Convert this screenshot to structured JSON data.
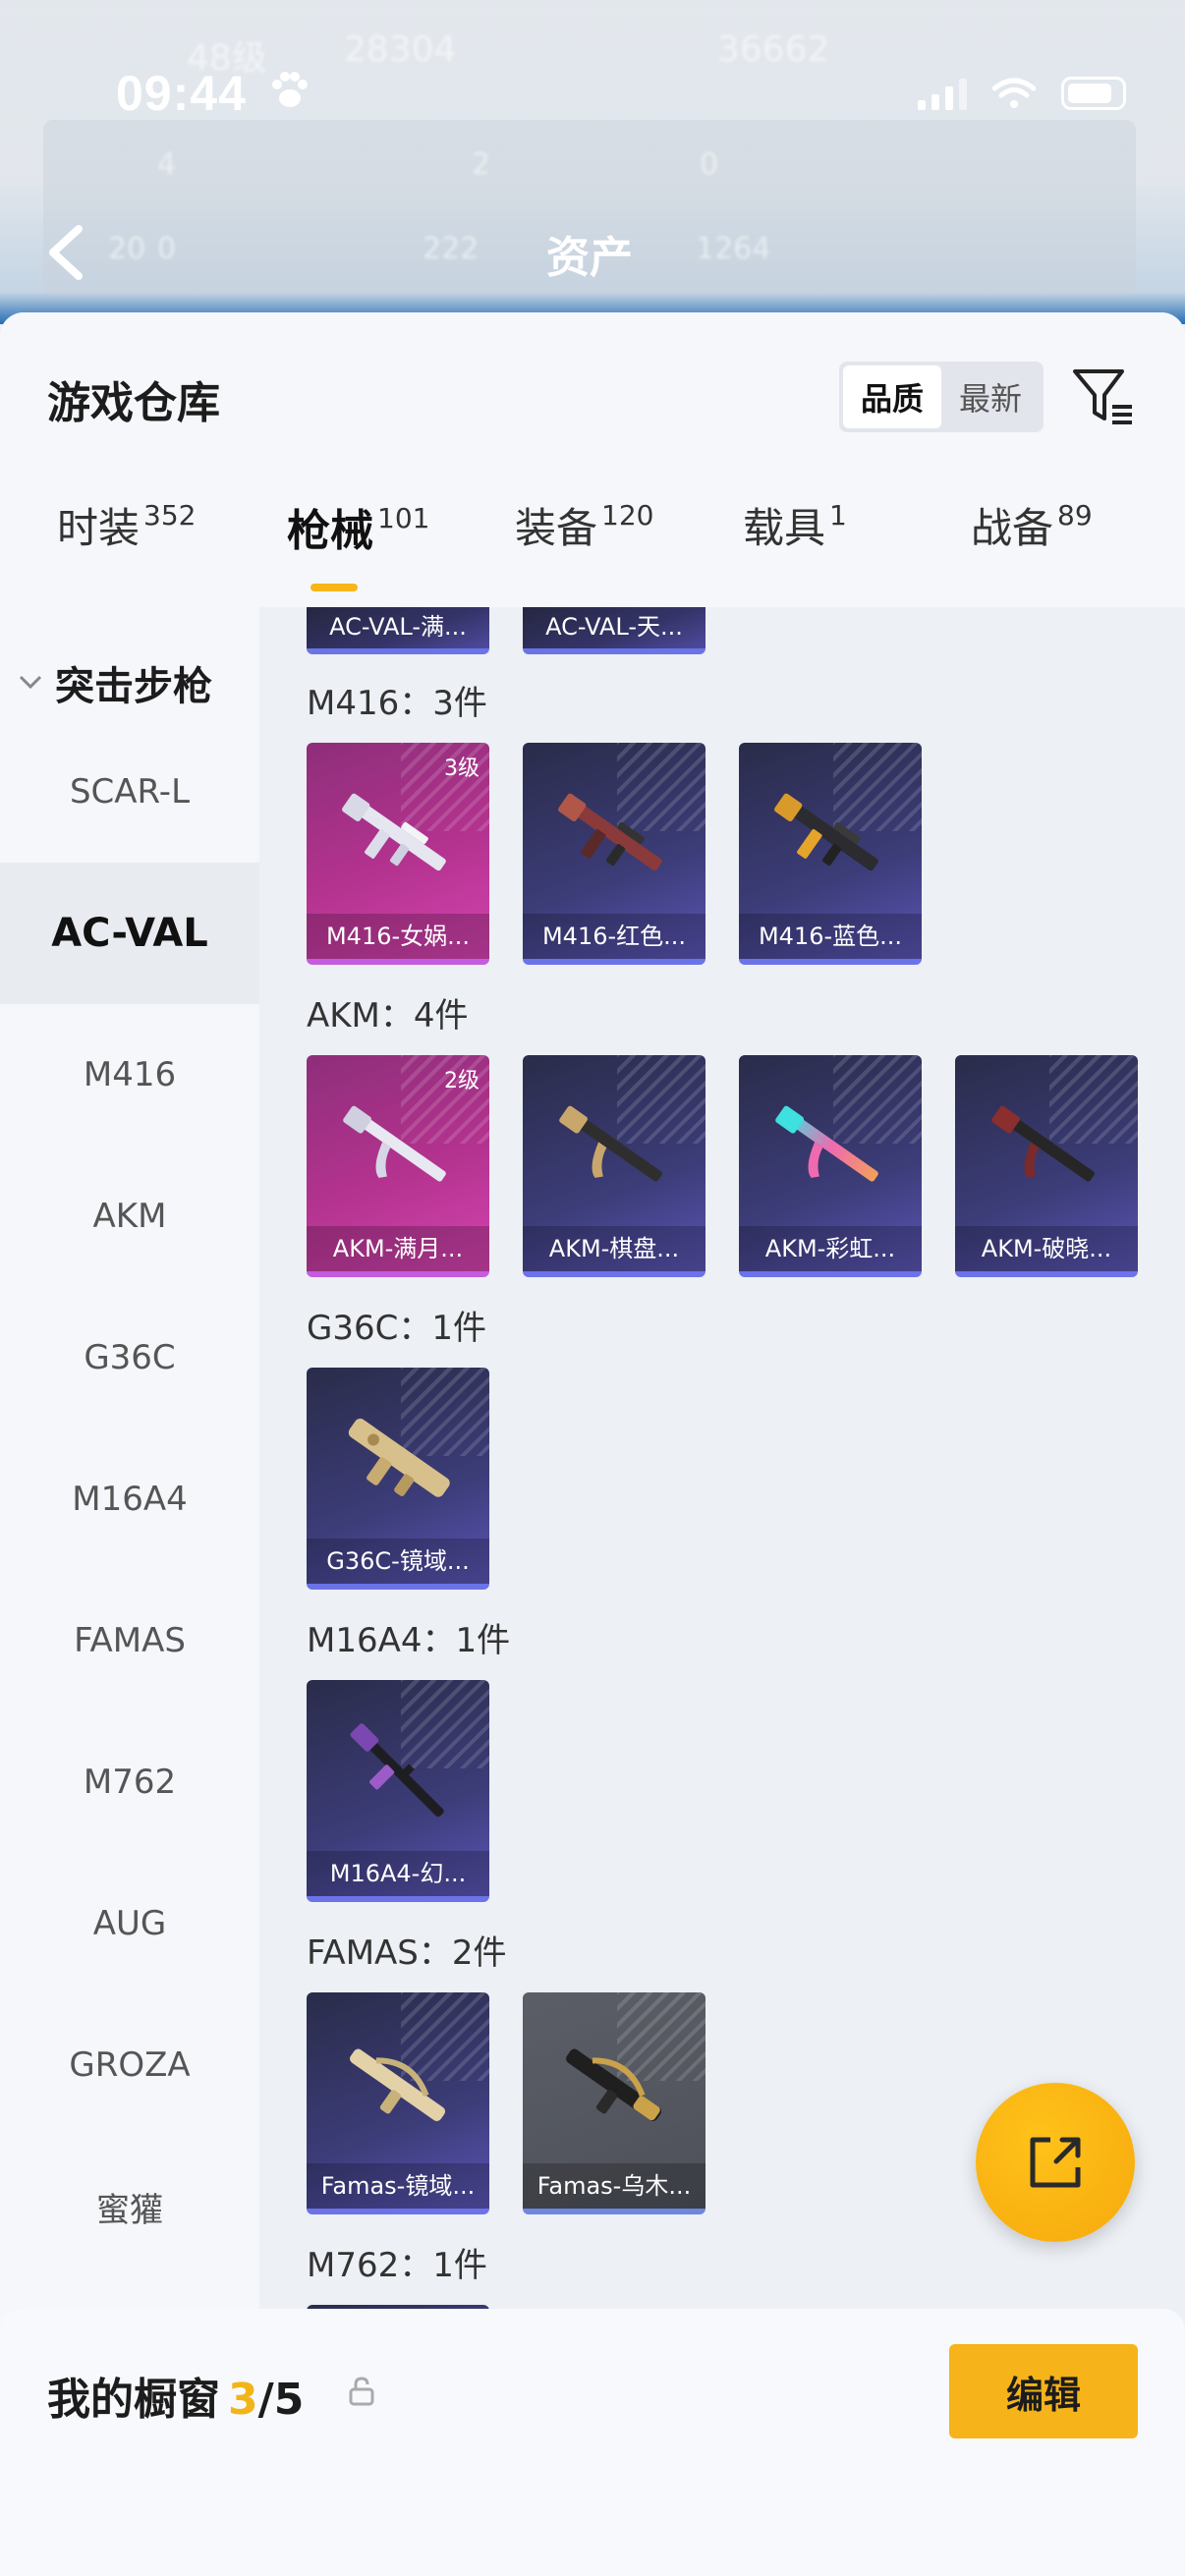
{
  "status_bar": {
    "time": "09:44"
  },
  "background": {
    "title": "资产",
    "ghost_texts": [
      "48级",
      "28304",
      "36662",
      "4",
      "2",
      "0",
      "20",
      "0",
      "222",
      "1264"
    ]
  },
  "header": {
    "title": "游戏仓库",
    "sort_options": [
      "品质",
      "最新"
    ],
    "sort_selected": "品质"
  },
  "tabs": [
    {
      "label": "时装",
      "count": "352"
    },
    {
      "label": "枪械",
      "count": "101",
      "active": true
    },
    {
      "label": "装备",
      "count": "120"
    },
    {
      "label": "载具",
      "count": "1"
    },
    {
      "label": "战备",
      "count": "89"
    }
  ],
  "sidebar": {
    "category": "突击步枪",
    "items": [
      "SCAR-L",
      "AC-VAL",
      "M416",
      "AKM",
      "G36C",
      "M16A4",
      "FAMAS",
      "M762",
      "AUG",
      "GROZA",
      "蜜獾"
    ],
    "active": "AC-VAL"
  },
  "groups": [
    {
      "title": "",
      "items": [
        {
          "label": "AC-VAL-满..."
        },
        {
          "label": "AC-VAL-天..."
        }
      ]
    },
    {
      "title": "M416：3件",
      "items": [
        {
          "label": "M416-女娲...",
          "level": "3级",
          "quality": "pink"
        },
        {
          "label": "M416-红色...",
          "quality": "purple"
        },
        {
          "label": "M416-蓝色...",
          "quality": "purple"
        }
      ]
    },
    {
      "title": "AKM：4件",
      "items": [
        {
          "label": "AKM-满月...",
          "level": "2级",
          "quality": "pink"
        },
        {
          "label": "AKM-棋盘...",
          "quality": "purple"
        },
        {
          "label": "AKM-彩虹...",
          "quality": "purple"
        },
        {
          "label": "AKM-破晓...",
          "quality": "purple"
        }
      ]
    },
    {
      "title": "G36C：1件",
      "items": [
        {
          "label": "G36C-镜域...",
          "quality": "purple"
        }
      ]
    },
    {
      "title": "M16A4：1件",
      "items": [
        {
          "label": "M16A4-幻...",
          "quality": "purple"
        }
      ]
    },
    {
      "title": "FAMAS：2件",
      "items": [
        {
          "label": "Famas-镜域...",
          "quality": "purple"
        },
        {
          "label": "Famas-乌木...",
          "quality": "gray"
        }
      ]
    },
    {
      "title": "M762：1件",
      "items": []
    }
  ],
  "showcase": {
    "label": "我的橱窗",
    "current": "3",
    "separator": "/",
    "total": "5",
    "edit_label": "编辑"
  },
  "colors": {
    "accent": "#f6b41a",
    "purple_card": "#3c3c78",
    "pink_card": "#b4338f",
    "gray_card": "#565960"
  }
}
